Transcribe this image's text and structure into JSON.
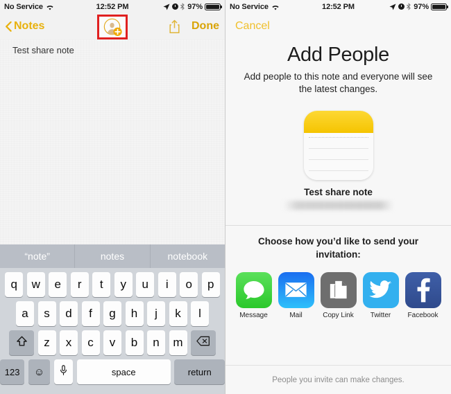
{
  "left": {
    "status": {
      "carrier": "No Service",
      "wifi_icon": "wifi-icon",
      "time": "12:52 PM",
      "location_icon": "location-arrow-icon",
      "alarm_icon": "alarm-clock-icon",
      "bluetooth_icon": "bluetooth-icon",
      "battery_percent": "97%",
      "battery_icon": "battery-icon"
    },
    "navbar": {
      "back_label": "Notes",
      "back_chevron_icon": "chevron-left-icon",
      "add_person_icon": "add-person-icon",
      "share_icon": "share-icon",
      "done_label": "Done"
    },
    "note": {
      "text": "Test share note",
      "add_button_icon": "plus-icon"
    },
    "keyboard": {
      "suggestions": [
        "“note”",
        "notes",
        "notebook"
      ],
      "row1": [
        "q",
        "w",
        "e",
        "r",
        "t",
        "y",
        "u",
        "i",
        "o",
        "p"
      ],
      "row2": [
        "a",
        "s",
        "d",
        "f",
        "g",
        "h",
        "j",
        "k",
        "l"
      ],
      "row3": [
        "z",
        "x",
        "c",
        "v",
        "b",
        "n",
        "m"
      ],
      "shift_icon": "shift-icon",
      "backspace_icon": "backspace-icon",
      "numeric_label": "123",
      "emoji_icon": "emoji-icon",
      "mic_icon": "microphone-icon",
      "space_label": "space",
      "return_label": "return"
    }
  },
  "right": {
    "status": {
      "carrier": "No Service",
      "wifi_icon": "wifi-icon",
      "time": "12:52 PM",
      "location_icon": "location-arrow-icon",
      "alarm_icon": "alarm-clock-icon",
      "bluetooth_icon": "bluetooth-icon",
      "battery_percent": "97%",
      "battery_icon": "battery-icon"
    },
    "cancel_label": "Cancel",
    "title": "Add People",
    "subtitle": "Add people to this note and everyone will see the latest changes.",
    "note_icon_name": "notes-app-icon",
    "note_title": "Test share note",
    "choose_text": "Choose how you’d like to send your invitation:",
    "share_options": [
      {
        "label": "Message",
        "icon": "message-bubble-icon",
        "color": "#2bc82b"
      },
      {
        "label": "Mail",
        "icon": "envelope-icon",
        "color": "#2ec0fb"
      },
      {
        "label": "Copy Link",
        "icon": "copy-pages-icon",
        "color": "#6e6e6e"
      },
      {
        "label": "Twitter",
        "icon": "twitter-bird-icon",
        "color": "#33b0ef"
      },
      {
        "label": "Facebook",
        "icon": "facebook-f-icon",
        "color": "#3f5fa8"
      }
    ],
    "footer_note": "People you invite can make changes."
  },
  "colors": {
    "accent_gold": "#d9a407",
    "highlight_red": "#e02020",
    "note_yellow": "#f5c400"
  }
}
